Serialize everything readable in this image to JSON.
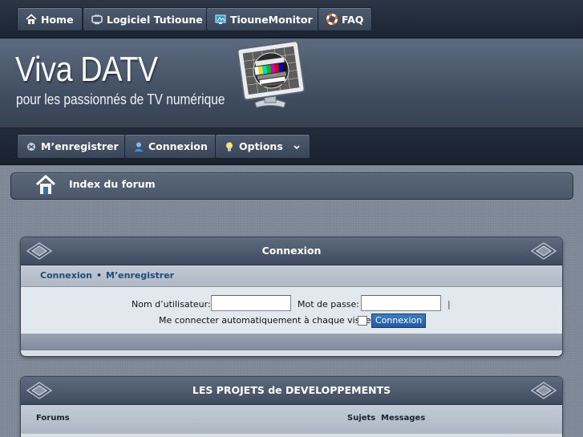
{
  "topnav": {
    "items": [
      {
        "label": "Home",
        "icon": "home-icon"
      },
      {
        "label": "Logiciel Tutioune",
        "icon": "tv-icon"
      },
      {
        "label": "TiouneMonitor",
        "icon": "monitor-icon"
      },
      {
        "label": "FAQ",
        "icon": "lifebuoy-icon"
      }
    ]
  },
  "banner": {
    "title": "Viva DATV",
    "tagline": "pour les passionnés de TV numérique"
  },
  "subnav": {
    "register": "M’enregistrer",
    "login": "Connexion",
    "options": "Options"
  },
  "breadcrumb": {
    "label": "Index du forum"
  },
  "login_panel": {
    "title": "Connexion",
    "links": [
      "Connexion",
      "M’enregistrer"
    ],
    "username_label": "Nom d’utilisateur:",
    "username_value": "",
    "password_label": "Mot de passe:",
    "password_value": "",
    "pipe": "|",
    "autologin_label": "Me connecter automatiquement à chaque visite",
    "autologin_checked": false,
    "submit": "Connexion"
  },
  "projects_panel": {
    "title": "LES PROJETS de DEVELOPPEMENTS",
    "columns": [
      "Forums",
      "Sujets",
      "Messages"
    ]
  },
  "colors": {
    "accent_blue": "#1f5aa4",
    "link_blue": "#1f4a7a",
    "nav_dark": "#1c2432"
  }
}
